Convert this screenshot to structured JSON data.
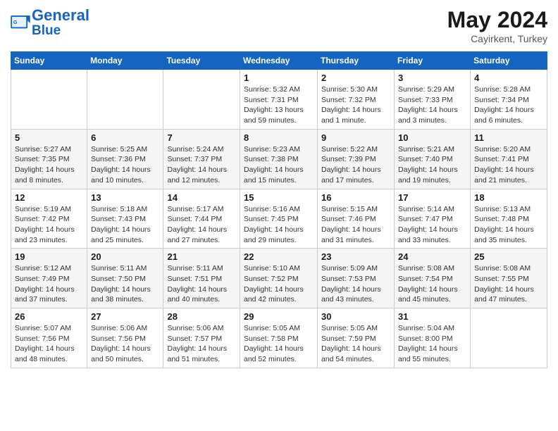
{
  "header": {
    "logo_line1": "General",
    "logo_line2": "Blue",
    "month_year": "May 2024",
    "location": "Cayirkent, Turkey"
  },
  "weekdays": [
    "Sunday",
    "Monday",
    "Tuesday",
    "Wednesday",
    "Thursday",
    "Friday",
    "Saturday"
  ],
  "weeks": [
    [
      {
        "day": "",
        "info": ""
      },
      {
        "day": "",
        "info": ""
      },
      {
        "day": "",
        "info": ""
      },
      {
        "day": "1",
        "info": "Sunrise: 5:32 AM\nSunset: 7:31 PM\nDaylight: 13 hours and 59 minutes."
      },
      {
        "day": "2",
        "info": "Sunrise: 5:30 AM\nSunset: 7:32 PM\nDaylight: 14 hours and 1 minute."
      },
      {
        "day": "3",
        "info": "Sunrise: 5:29 AM\nSunset: 7:33 PM\nDaylight: 14 hours and 3 minutes."
      },
      {
        "day": "4",
        "info": "Sunrise: 5:28 AM\nSunset: 7:34 PM\nDaylight: 14 hours and 6 minutes."
      }
    ],
    [
      {
        "day": "5",
        "info": "Sunrise: 5:27 AM\nSunset: 7:35 PM\nDaylight: 14 hours and 8 minutes."
      },
      {
        "day": "6",
        "info": "Sunrise: 5:25 AM\nSunset: 7:36 PM\nDaylight: 14 hours and 10 minutes."
      },
      {
        "day": "7",
        "info": "Sunrise: 5:24 AM\nSunset: 7:37 PM\nDaylight: 14 hours and 12 minutes."
      },
      {
        "day": "8",
        "info": "Sunrise: 5:23 AM\nSunset: 7:38 PM\nDaylight: 14 hours and 15 minutes."
      },
      {
        "day": "9",
        "info": "Sunrise: 5:22 AM\nSunset: 7:39 PM\nDaylight: 14 hours and 17 minutes."
      },
      {
        "day": "10",
        "info": "Sunrise: 5:21 AM\nSunset: 7:40 PM\nDaylight: 14 hours and 19 minutes."
      },
      {
        "day": "11",
        "info": "Sunrise: 5:20 AM\nSunset: 7:41 PM\nDaylight: 14 hours and 21 minutes."
      }
    ],
    [
      {
        "day": "12",
        "info": "Sunrise: 5:19 AM\nSunset: 7:42 PM\nDaylight: 14 hours and 23 minutes."
      },
      {
        "day": "13",
        "info": "Sunrise: 5:18 AM\nSunset: 7:43 PM\nDaylight: 14 hours and 25 minutes."
      },
      {
        "day": "14",
        "info": "Sunrise: 5:17 AM\nSunset: 7:44 PM\nDaylight: 14 hours and 27 minutes."
      },
      {
        "day": "15",
        "info": "Sunrise: 5:16 AM\nSunset: 7:45 PM\nDaylight: 14 hours and 29 minutes."
      },
      {
        "day": "16",
        "info": "Sunrise: 5:15 AM\nSunset: 7:46 PM\nDaylight: 14 hours and 31 minutes."
      },
      {
        "day": "17",
        "info": "Sunrise: 5:14 AM\nSunset: 7:47 PM\nDaylight: 14 hours and 33 minutes."
      },
      {
        "day": "18",
        "info": "Sunrise: 5:13 AM\nSunset: 7:48 PM\nDaylight: 14 hours and 35 minutes."
      }
    ],
    [
      {
        "day": "19",
        "info": "Sunrise: 5:12 AM\nSunset: 7:49 PM\nDaylight: 14 hours and 37 minutes."
      },
      {
        "day": "20",
        "info": "Sunrise: 5:11 AM\nSunset: 7:50 PM\nDaylight: 14 hours and 38 minutes."
      },
      {
        "day": "21",
        "info": "Sunrise: 5:11 AM\nSunset: 7:51 PM\nDaylight: 14 hours and 40 minutes."
      },
      {
        "day": "22",
        "info": "Sunrise: 5:10 AM\nSunset: 7:52 PM\nDaylight: 14 hours and 42 minutes."
      },
      {
        "day": "23",
        "info": "Sunrise: 5:09 AM\nSunset: 7:53 PM\nDaylight: 14 hours and 43 minutes."
      },
      {
        "day": "24",
        "info": "Sunrise: 5:08 AM\nSunset: 7:54 PM\nDaylight: 14 hours and 45 minutes."
      },
      {
        "day": "25",
        "info": "Sunrise: 5:08 AM\nSunset: 7:55 PM\nDaylight: 14 hours and 47 minutes."
      }
    ],
    [
      {
        "day": "26",
        "info": "Sunrise: 5:07 AM\nSunset: 7:56 PM\nDaylight: 14 hours and 48 minutes."
      },
      {
        "day": "27",
        "info": "Sunrise: 5:06 AM\nSunset: 7:56 PM\nDaylight: 14 hours and 50 minutes."
      },
      {
        "day": "28",
        "info": "Sunrise: 5:06 AM\nSunset: 7:57 PM\nDaylight: 14 hours and 51 minutes."
      },
      {
        "day": "29",
        "info": "Sunrise: 5:05 AM\nSunset: 7:58 PM\nDaylight: 14 hours and 52 minutes."
      },
      {
        "day": "30",
        "info": "Sunrise: 5:05 AM\nSunset: 7:59 PM\nDaylight: 14 hours and 54 minutes."
      },
      {
        "day": "31",
        "info": "Sunrise: 5:04 AM\nSunset: 8:00 PM\nDaylight: 14 hours and 55 minutes."
      },
      {
        "day": "",
        "info": ""
      }
    ]
  ]
}
